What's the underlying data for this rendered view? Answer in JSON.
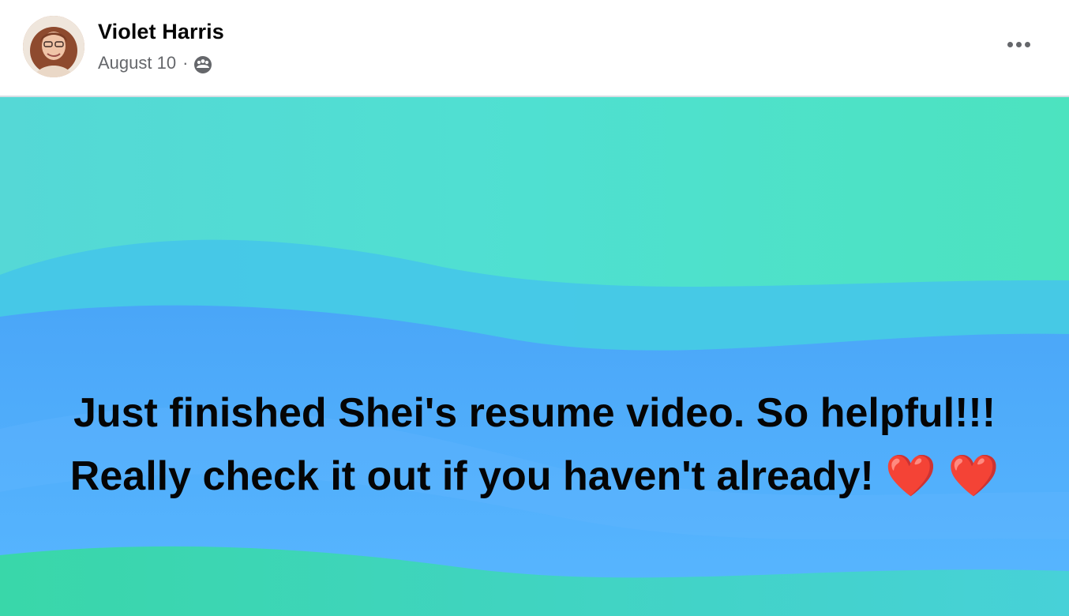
{
  "post": {
    "author": "Violet Harris",
    "date": "August 10",
    "separator": "·",
    "audience_icon": "group-audience-icon",
    "more_icon": "more-options-icon",
    "text": "Just finished Shei's resume video. So helpful!!! Really check it out if you haven't already! ❤️ ❤️"
  },
  "colors": {
    "background_top": "#5ee0c8",
    "background_middle": "#4aa8f8",
    "background_bottom": "#3fd7b0",
    "author_text": "#050505",
    "meta_text": "#65676b"
  }
}
